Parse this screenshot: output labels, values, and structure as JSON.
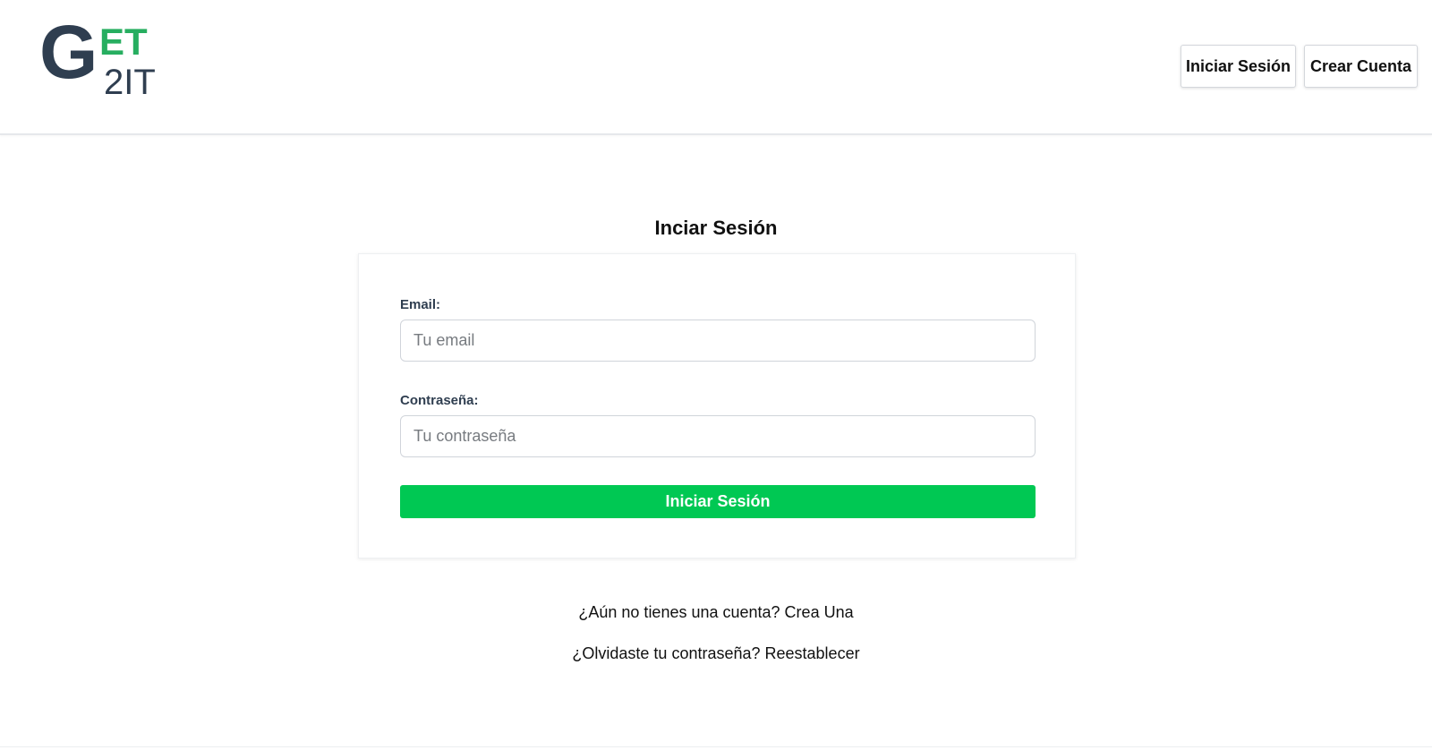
{
  "logo": {
    "g": "G",
    "et": "ET",
    "two_it": "2IT",
    "colors": {
      "dark": "#2f3e50",
      "green": "#27ae60"
    }
  },
  "nav": {
    "login_label": "Iniciar Sesión",
    "register_label": "Crear Cuenta"
  },
  "main": {
    "title": "Inciar Sesión",
    "form": {
      "email_label": "Email:",
      "email_placeholder": "Tu email",
      "email_value": "",
      "password_label": "Contraseña:",
      "password_placeholder": "Tu contraseña",
      "password_value": "",
      "submit_label": "Iniciar Sesión",
      "submit_color": "#00c853"
    },
    "links": {
      "register": "¿Aún no tienes una cuenta? Crea Una",
      "reset": "¿Olvidaste tu contraseña? Reestablecer"
    }
  }
}
